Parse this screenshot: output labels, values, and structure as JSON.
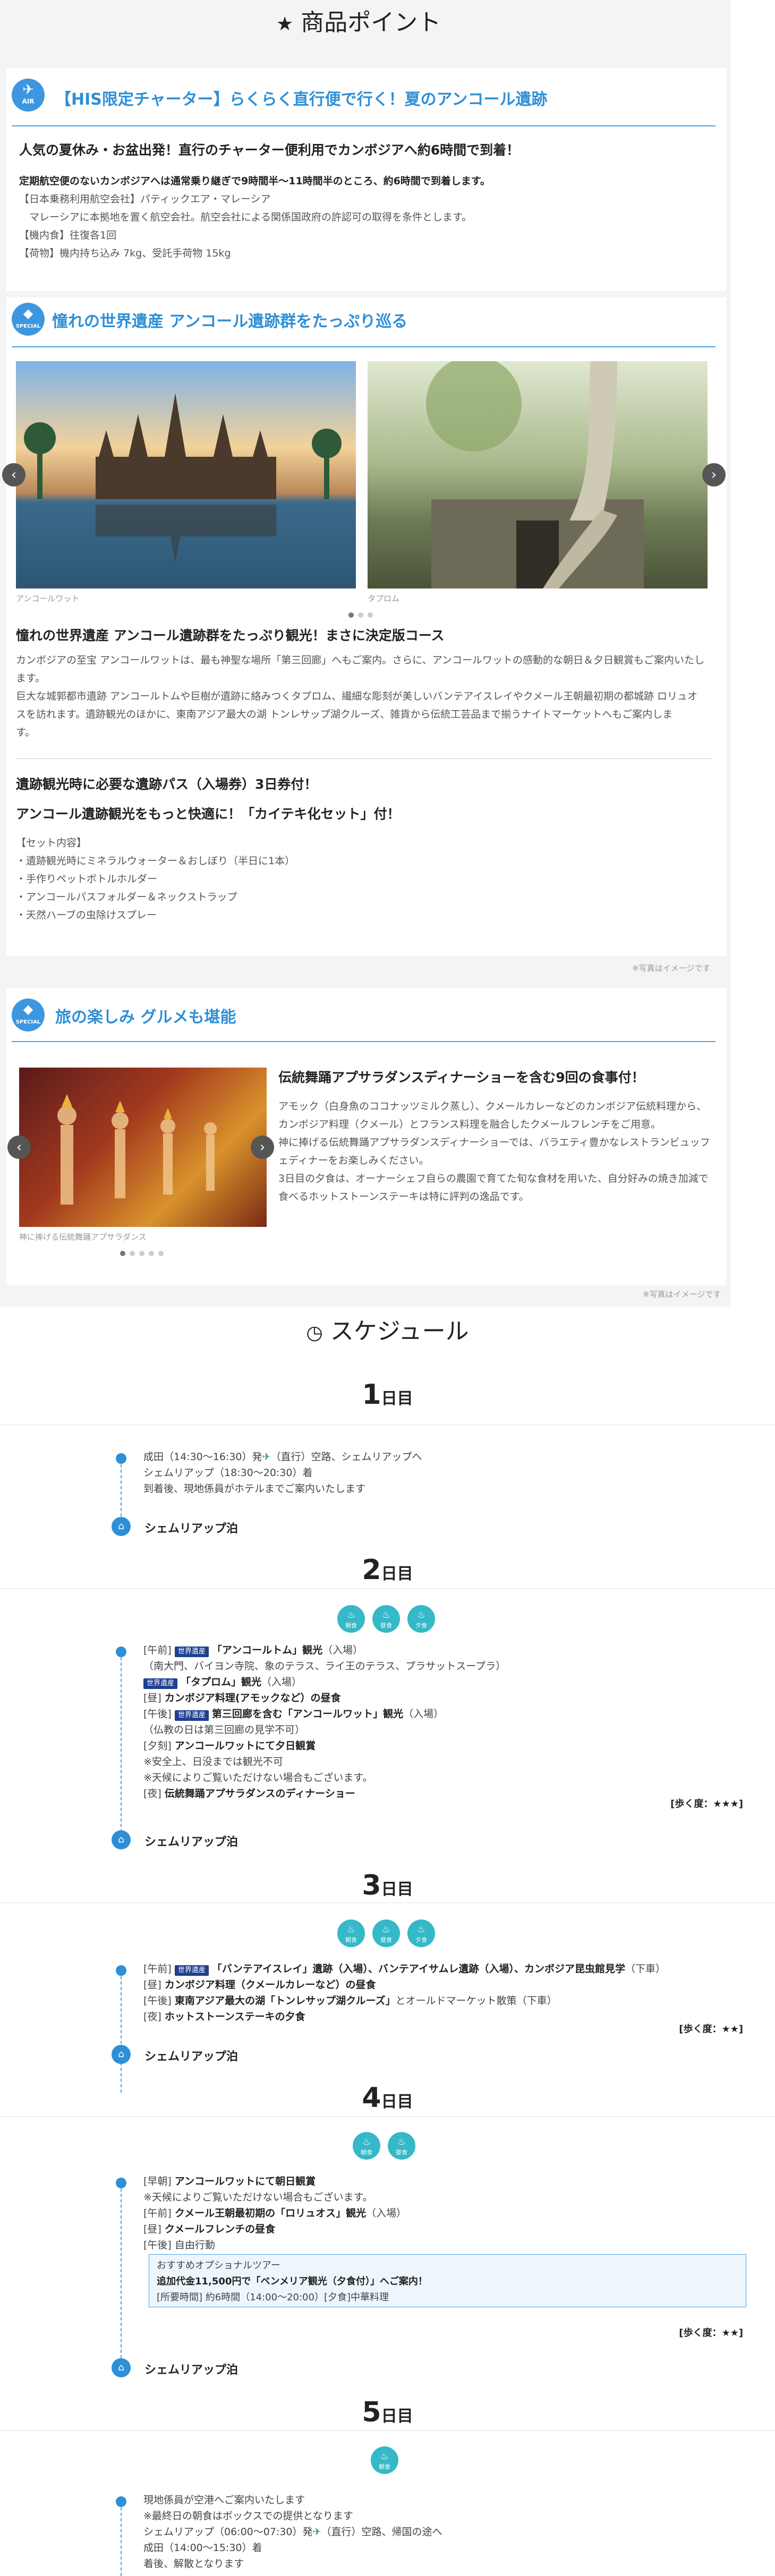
{
  "header": {
    "title": "商品ポイント",
    "icon": "star-icon"
  },
  "section_air": {
    "badge": "AIR",
    "heading": "【HIS限定チャーター】らくらく直行便で行く！夏のアンコール遺跡",
    "lead": "人気の夏休み・お盆出発！直行のチャーター便利用でカンボジアへ約6時間で到着！",
    "sub": "定期航空便のないカンボジアへは通常乗り継ぎで9時間半〜11時間半のところ、約6時間で到着します。",
    "lines": [
      "【日本乗務利用航空会社】パティックエア・マレーシア",
      "　マレーシアに本拠地を置く航空会社。航空会社による関係国政府の許認可の取得を条件とします。",
      "【機内食】往復各1回",
      "【荷物】機内持ち込み 7kg、受託手荷物 15kg"
    ]
  },
  "section_special1": {
    "badge": "SPECIAL",
    "heading": "憧れの世界遺産 アンコール遺跡群をたっぷり巡る",
    "captions": [
      "アンコールワット",
      "タプロム"
    ],
    "lead": "憧れの世界遺産 アンコール遺跡群をたっぷり観光！まさに決定版コース",
    "lines": [
      "カンボジアの至宝 アンコールワットは、最も神聖な場所「第三回廊」へもご案内。さらに、アンコールワットの感動的な朝日＆夕日観賞もご案内いたし",
      "ます。",
      "巨大な城郭都市遺跡 アンコールトムや巨樹が遺跡に絡みつくタプロム、繊細な彫刻が美しいバンテアイスレイやクメール王朝最初期の都城跡 ロリュオ",
      "スを訪れます。遺跡観光のほかに、東南アジア最大の湖 トンレサップ湖クルーズ、雑貨から伝統工芸品まで揃うナイトマーケットへもご案内しま",
      "す。"
    ],
    "pass": "遺跡観光時に必要な遺跡パス（入場券）3日券付！",
    "kit": "アンコール遺跡観光をもっと快適に！「カイテキ化セット」付！",
    "kit_items": [
      "【セット内容】",
      "・遺跡観光時にミネラルウォーター＆おしぼり（半日に1本）",
      "・手作りペットボトルホルダー",
      "・アンコールパスフォルダー＆ネックストラップ",
      "・天然ハーブの虫除けスプレー"
    ],
    "note": "※写真はイメージです"
  },
  "section_special2": {
    "badge": "SPECIAL",
    "heading": "旅の楽しみ グルメも堪能",
    "caption": "神に捧げる伝統舞踊アプサラダンス",
    "lead": "伝統舞踊アプサラダンスディナーショーを含む9回の食事付！",
    "lines": [
      "アモック（白身魚のココナッツミルク蒸し）、クメールカレーなどのカンボジア伝統料理から、",
      "カンボジア料理（クメール）とフランス料理を融合したクメールフレンチをご用意。",
      "神に捧げる伝統舞踊アプサラダンスディナーショーでは、バラエティ豊かなレストランビュッフ",
      "ェディナーをお楽しみください。",
      "3日目の夕食は、オーナーシェフ自らの農園で育てた旬な食材を用いた、自分好みの焼き加減で",
      "食べるホットストーンステーキは特に評判の逸品です。"
    ],
    "note": "※写真はイメージです"
  },
  "schedule": {
    "title": "スケジュール",
    "day_unit": "日目",
    "stay_label": "シェムリアップ泊",
    "walk_3": "[歩く度：★★★]",
    "walk_2": "[歩く度：★★]",
    "tag_world": "世界遺産",
    "meal_breakfast": "朝食",
    "meal_lunch": "昼食",
    "meal_dinner": "夕食",
    "day1": {
      "num": "1",
      "lines": [
        "成田（14:30〜16:30）発",
        "（直行）空路、シェムリアップへ",
        "シェムリアップ（18:30〜20:30）着",
        "到着後、現地係員がホテルまでご案内いたします"
      ]
    },
    "day2": {
      "num": "2",
      "a1": "[午前]",
      "a2": "「アンコールトム」観光",
      "a3": "（入場）",
      "b": "（南大門、バイヨン寺院、象のテラス、ライ王のテラス、プラサットスープラ）",
      "c1": "「タプロム」観光",
      "c2": "（入場）",
      "d1": "[昼]",
      "d2": "カンボジア料理(アモックなど）の昼食",
      "e1": "[午後]",
      "e2": "第三回廊を含む「アンコールワット」観光",
      "e3": "（入場）",
      "f": "（仏教の日は第三回廊の見学不可）",
      "g1": "[夕刻]",
      "g2": "アンコールワットにて夕日観賞",
      "h": "※安全上、日没までは観光不可",
      "i": "※天候によりご覧いただけない場合もございます。",
      "j1": "[夜]",
      "j2": "伝統舞踊アプサラダンスのディナーショー"
    },
    "day3": {
      "num": "3",
      "a1": "[午前]",
      "a2": "「バンテアイスレイ」遺跡（入場）、バンテアイサムレ遺跡（入場）、カンボジア昆虫館見学",
      "a3": "（下車）",
      "b1": "[昼]",
      "b2": "カンボジア料理（クメールカレーなど）の昼食",
      "c1": "[午後]",
      "c2": "東南アジア最大の湖「トンレサップ湖クルーズ」",
      "c3": "とオールドマーケット散策（下車）",
      "d1": "[夜]",
      "d2": "ホットストーンステーキの夕食"
    },
    "day4": {
      "num": "4",
      "a1": "[早朝]",
      "a2": "アンコールワットにて朝日観賞",
      "b": "※天候によりご覧いただけない場合もございます。",
      "c1": "[午前]",
      "c2": "クメール王朝最初期の「ロリュオス」観光",
      "c3": "（入場）",
      "d1": "[昼]",
      "d2": "クメールフレンチの昼食",
      "e": "[午後] 自由行動",
      "opt1": "おすすめオプショナルツアー",
      "opt2": "追加代金11,500円で「ベンメリア観光（夕食付）」へご案内！",
      "opt3": "[所要時間] 約6時間（14:00〜20:00）[夕食]中華料理"
    },
    "day5": {
      "num": "5",
      "lines": [
        "現地係員が空港へご案内いたします",
        "※最終日の朝食はボックスでの提供となります",
        "シェムリアップ（06:00〜07:30）発",
        "（直行）空路、帰国の途へ",
        "成田（14:00〜15:30）着",
        "着後、解散となります"
      ]
    }
  },
  "colors": {
    "accent": "#2e8fd6",
    "meal": "#35b8c8",
    "tag": "#1f3f8f"
  }
}
